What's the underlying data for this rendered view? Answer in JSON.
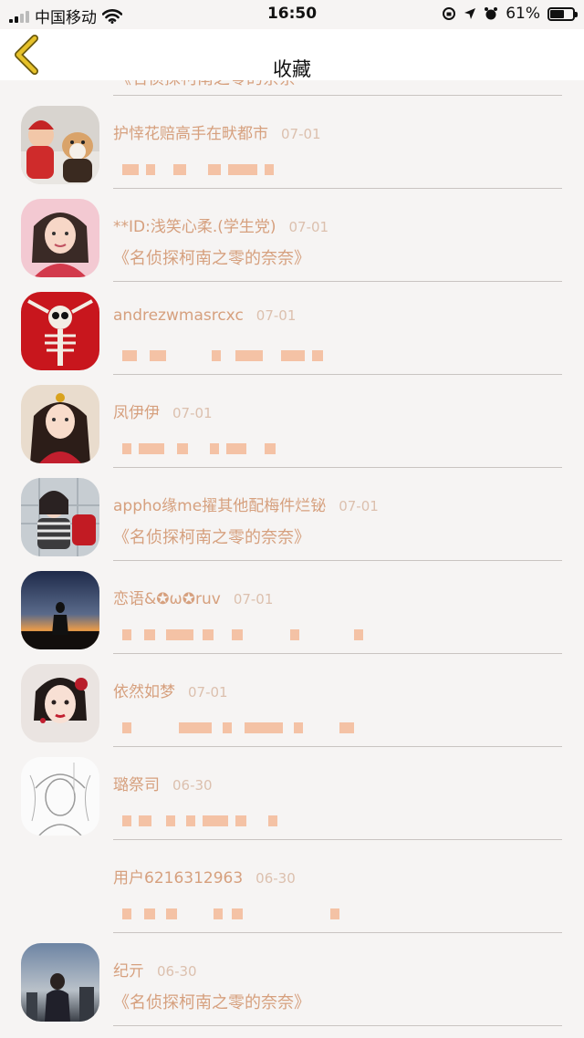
{
  "status_bar": {
    "carrier": "中国移动",
    "time": "16:50",
    "battery_percent": "61%",
    "battery_level": 0.61
  },
  "nav": {
    "title": "收藏"
  },
  "partial_top_message": "《名侦探柯南之零的奈奈",
  "items": [
    {
      "name": "护悻花赔高手在畎都市",
      "time": "07-01",
      "message": ""
    },
    {
      "name": "**ID:浅笑心柔.(学生党)",
      "time": "07-01",
      "message": "《名侦探柯南之零的奈奈》"
    },
    {
      "name": "andrezwmasrcxc",
      "time": "07-01",
      "message": ""
    },
    {
      "name": "凤伊伊",
      "time": "07-01",
      "message": ""
    },
    {
      "name": "appho缘me擢其他配梅件烂铋",
      "time": "07-01",
      "message": "《名侦探柯南之零的奈奈》"
    },
    {
      "name": "恋语&✪ω✪ruv",
      "time": "07-01",
      "message": ""
    },
    {
      "name": "依然如梦",
      "time": "07-01",
      "message": ""
    },
    {
      "name": "璐祭司",
      "time": "06-30",
      "message": ""
    },
    {
      "name": "用户6216312963",
      "time": "06-30",
      "message": ""
    },
    {
      "name": "纪亓",
      "time": "06-30",
      "message": "《名侦探柯南之零的奈奈》"
    }
  ],
  "colors": {
    "accent_text": "#d6a07e",
    "time_text": "#dcc0ae",
    "background": "#f6f4f3",
    "back_arrow": "#e6c12a"
  }
}
